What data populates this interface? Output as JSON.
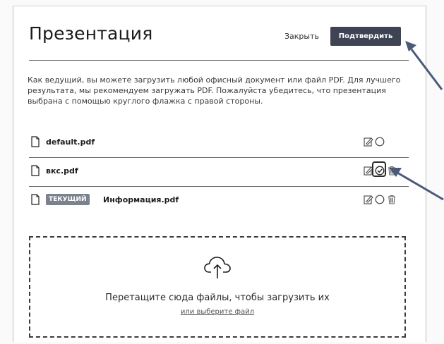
{
  "dialog": {
    "title": "Презентация",
    "close_label": "Закрыть",
    "confirm_label": "Подтвердить",
    "info_text": "Как ведущий, вы можете загрузить любой офисный документ или файл PDF. Для лучшего результата, мы рекомендуем загружать PDF. Пожалуйста убедитесь, что презентация выбрана с помощью круглого флажка с правой стороны."
  },
  "files": [
    {
      "name": "default.pdf",
      "badge": "",
      "selected": false,
      "icons": [
        "file-icon",
        "edit-icon",
        "radio-icon"
      ]
    },
    {
      "name": "вкс.pdf",
      "badge": "",
      "selected": true,
      "icons": [
        "file-icon",
        "edit-icon",
        "radio-checked-icon",
        "trash-icon"
      ]
    },
    {
      "name": "Информация.pdf",
      "badge": "ТЕКУЩИЙ",
      "selected": false,
      "icons": [
        "file-icon",
        "edit-icon",
        "radio-icon",
        "trash-icon"
      ]
    }
  ],
  "dropzone": {
    "text": "Перетащите сюда файлы, чтобы загрузить их",
    "link": "или выберите файл",
    "icon": "cloud-upload-icon"
  },
  "colors": {
    "confirm_bg": "#3e4453",
    "badge_bg": "#7b818d",
    "arrow": "#4a5a78"
  }
}
